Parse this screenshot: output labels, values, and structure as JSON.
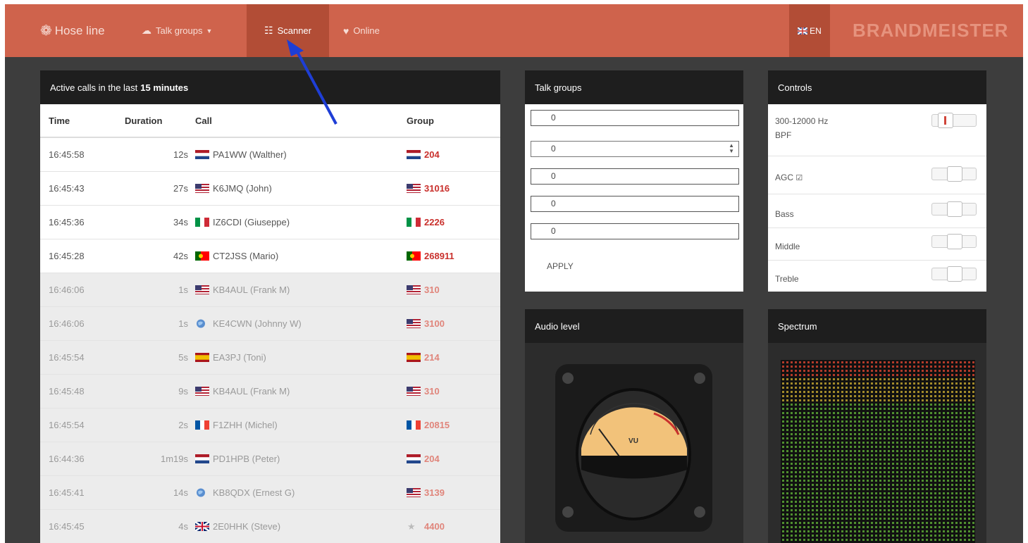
{
  "navbar": {
    "brand": "Hose line",
    "talk_groups": "Talk groups",
    "scanner": "Scanner",
    "online": "Online",
    "lang": "EN",
    "logo": "BRANDMEISTER"
  },
  "calls": {
    "title_prefix": "Active calls in the last",
    "title_bold": "15 minutes",
    "headers": [
      "Time",
      "Duration",
      "Call",
      "Group"
    ],
    "rows": [
      {
        "time": "16:45:58",
        "duration": "12s",
        "call": "PA1WW (Walther)",
        "flag": "nl",
        "group": "204",
        "group_flag": "nl",
        "faded": false
      },
      {
        "time": "16:45:43",
        "duration": "27s",
        "call": "K6JMQ (John)",
        "flag": "us",
        "group": "31016",
        "group_flag": "us",
        "faded": false
      },
      {
        "time": "16:45:36",
        "duration": "34s",
        "call": "IZ6CDI (Giuseppe)",
        "flag": "it",
        "group": "2226",
        "group_flag": "it",
        "faded": false
      },
      {
        "time": "16:45:28",
        "duration": "42s",
        "call": "CT2JSS (Mario)",
        "flag": "pt",
        "group": "268911",
        "group_flag": "pt",
        "faded": false
      },
      {
        "time": "16:46:06",
        "duration": "1s",
        "call": "KB4AUL (Frank M)",
        "flag": "us",
        "group": "310",
        "group_flag": "us",
        "faded": true
      },
      {
        "time": "16:46:06",
        "duration": "1s",
        "call": "KE4CWN (Johnny W)",
        "flag": "globe",
        "group": "3100",
        "group_flag": "us",
        "faded": true
      },
      {
        "time": "16:45:54",
        "duration": "5s",
        "call": "EA3PJ (Toni)",
        "flag": "es",
        "group": "214",
        "group_flag": "es",
        "faded": true
      },
      {
        "time": "16:45:48",
        "duration": "9s",
        "call": "KB4AUL (Frank M)",
        "flag": "us",
        "group": "310",
        "group_flag": "us",
        "faded": true
      },
      {
        "time": "16:45:54",
        "duration": "2s",
        "call": "F1ZHH (Michel)",
        "flag": "fr",
        "group": "20815",
        "group_flag": "fr",
        "faded": true
      },
      {
        "time": "16:44:36",
        "duration": "1m19s",
        "call": "PD1HPB (Peter)",
        "flag": "nl",
        "group": "204",
        "group_flag": "nl",
        "faded": true
      },
      {
        "time": "16:45:41",
        "duration": "14s",
        "call": "KB8QDX (Ernest G)",
        "flag": "globe",
        "group": "3139",
        "group_flag": "us",
        "faded": true
      },
      {
        "time": "16:45:45",
        "duration": "4s",
        "call": "2E0HHK (Steve)",
        "flag": "gb",
        "group": "4400",
        "group_flag": "star",
        "faded": true
      }
    ]
  },
  "talk_groups": {
    "title": "Talk groups",
    "inputs": [
      "0",
      "0",
      "0",
      "0",
      "0"
    ],
    "apply": "APPLY"
  },
  "controls": {
    "title": "Controls",
    "bpf_label": "300-12000 Hz",
    "bpf_label2": "BPF",
    "agc_label": "AGC",
    "bass_label": "Bass",
    "middle_label": "Middle",
    "treble_label": "Treble"
  },
  "audio": {
    "title": "Audio level",
    "vu": "VU"
  },
  "spectrum": {
    "title": "Spectrum"
  },
  "colors": {
    "navbar": "#cf634c",
    "active_nav": "#b24d36",
    "panel_header": "#1e1e1e",
    "group_red": "#c9302c"
  }
}
